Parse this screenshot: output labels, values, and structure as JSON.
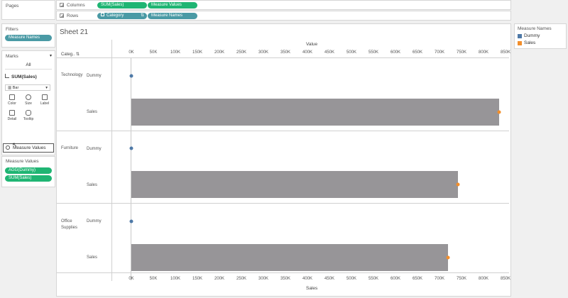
{
  "pages": {
    "title": "Pages"
  },
  "columns_shelf": {
    "label": "Columns",
    "pills": [
      "SUM(Sales)",
      "Measure Values"
    ]
  },
  "rows_shelf": {
    "label": "Rows",
    "pills": [
      "Category",
      "Measure Names"
    ]
  },
  "filters": {
    "title": "Filters",
    "pill": "Measure Names"
  },
  "marks": {
    "title": "Marks",
    "all_label": "All",
    "sum_sales_label": "SUM(Sales)",
    "mark_type": "Bar",
    "cards": [
      "Color",
      "Size",
      "Label",
      "Detail",
      "Tooltip"
    ],
    "drag_item": "Measure Values"
  },
  "measure_values": {
    "title": "Measure Values",
    "pills": [
      "AGG(Dummy)",
      "SUM(Sales)"
    ]
  },
  "sheet": {
    "title": "Sheet 21",
    "header_category": "Categ..",
    "value_axis_title": "Value",
    "bottom_axis_title": "Sales"
  },
  "legend": {
    "title": "Measure Names",
    "items": [
      {
        "name": "Dummy",
        "color": "#4e79a7"
      },
      {
        "name": "Sales",
        "color": "#f28e2b"
      }
    ]
  },
  "colors": {
    "bar": "#979598",
    "green_pill": "#1fb573",
    "teal_pill": "#4a9aa5"
  },
  "chart_data": {
    "type": "bar",
    "xlabel": "Sales",
    "x_title_top": "Value",
    "xlim": [
      0,
      850000
    ],
    "ticks": [
      "0K",
      "50K",
      "100K",
      "150K",
      "200K",
      "250K",
      "300K",
      "350K",
      "400K",
      "450K",
      "500K",
      "550K",
      "600K",
      "650K",
      "700K",
      "750K",
      "800K",
      "850K"
    ],
    "categories": [
      "Technology",
      "Furniture",
      "Office Supplies"
    ],
    "measure_rows": [
      "Dummy",
      "Sales"
    ],
    "series": [
      {
        "name": "Dummy",
        "values": [
          0,
          0,
          0
        ]
      },
      {
        "name": "Sales",
        "values": [
          836154,
          741999,
          719047
        ]
      }
    ]
  }
}
